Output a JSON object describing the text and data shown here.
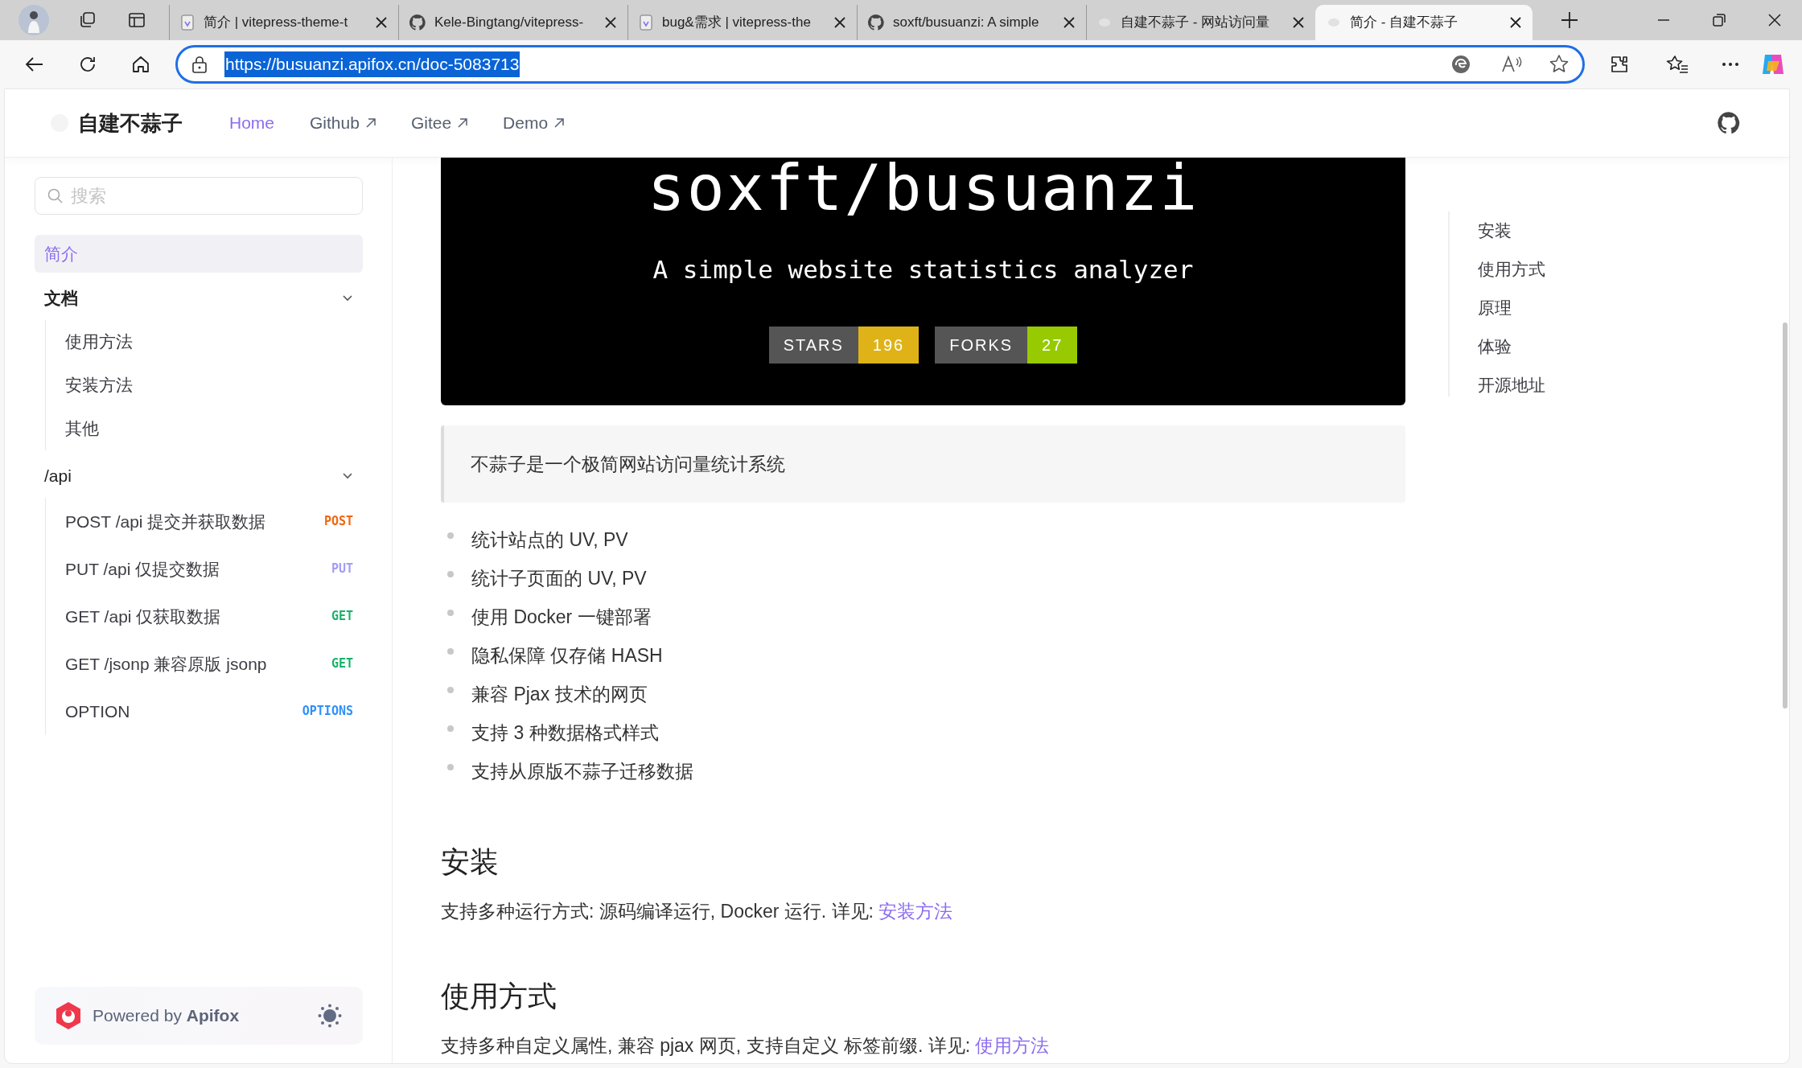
{
  "browser": {
    "tabs": [
      {
        "title": "简介 | vitepress-theme-t",
        "kind": "doc",
        "selected": false
      },
      {
        "title": "Kele-Bingtang/vitepress-",
        "kind": "github",
        "selected": false
      },
      {
        "title": "bug&需求 | vitepress-the",
        "kind": "doc",
        "selected": false
      },
      {
        "title": "soxft/busuanzi: A simple",
        "kind": "github",
        "selected": false
      },
      {
        "title": "自建不蒜子 - 网站访问量",
        "kind": "faint",
        "selected": false
      },
      {
        "title": "简介 - 自建不蒜子",
        "kind": "faint",
        "selected": true
      }
    ],
    "address": "https://busuanzi.apifox.cn/doc-5083713"
  },
  "site": {
    "title": "自建不蒜子",
    "nav": [
      {
        "label": "Home",
        "external": false,
        "selected": true
      },
      {
        "label": "Github",
        "external": true,
        "selected": false
      },
      {
        "label": "Gitee",
        "external": true,
        "selected": false
      },
      {
        "label": "Demo",
        "external": true,
        "selected": false
      }
    ]
  },
  "sidebar": {
    "search": {
      "placeholder": "搜索"
    },
    "items": [
      {
        "label": "简介",
        "kind": "page",
        "selected": true
      },
      {
        "label": "文档",
        "kind": "heading",
        "expanded": true,
        "children": [
          {
            "label": "使用方法",
            "selected": false
          },
          {
            "label": "安装方法",
            "selected": false
          },
          {
            "label": "其他",
            "selected": false
          }
        ]
      },
      {
        "label": "/api",
        "kind": "folder",
        "expanded": true,
        "children": [
          {
            "label": "POST /api 提交并获取数据",
            "method": "POST",
            "color": "#f0670f",
            "selected": false
          },
          {
            "label": "PUT /api 仅提交数据",
            "method": "PUT",
            "color": "#a39bf7",
            "selected": false
          },
          {
            "label": "GET /api 仅获取数据",
            "method": "GET",
            "color": "#17b26a",
            "selected": false
          },
          {
            "label": "GET /jsonp 兼容原版 jsonp",
            "method": "GET",
            "color": "#17b26a",
            "selected": false
          },
          {
            "label": "OPTION",
            "method": "OPTIONS",
            "color": "#2e90fa",
            "selected": false
          }
        ]
      }
    ],
    "footer": {
      "text": "Powered by **Apifox**"
    }
  },
  "banner": {
    "title": "soxft/**busuanzi**",
    "subtitle": "A simple website statistics analyzer",
    "badges": [
      {
        "label": "STARS",
        "value": "196",
        "color": "#dfb317"
      },
      {
        "label": "FORKS",
        "value": "27",
        "color": "#97ca00"
      }
    ]
  },
  "intro": "不蒜子是一个极简网站访问量统计系统",
  "features": [
    "统计站点的 UV, PV",
    "统计子页面的 UV, PV",
    "使用 Docker 一键部署",
    "隐私保障 仅存储 HASH",
    "兼容 Pjax 技术的网页",
    "支持 3 种数据格式样式",
    "支持从原版不蒜子迁移数据"
  ],
  "sections": [
    {
      "heading": "安装",
      "text": "支持多种运行方式: 源码编译运行, Docker 运行. 详见: ",
      "link": "安装方法"
    },
    {
      "heading": "使用方式",
      "text": "支持多种自定义属性, 兼容 pjax 网页, 支持自定义 标签前缀. 详见: ",
      "link": "使用方法"
    }
  ],
  "toc": [
    {
      "label": "安装"
    },
    {
      "label": "使用方式"
    },
    {
      "label": "原理"
    },
    {
      "label": "体验"
    },
    {
      "label": "开源地址"
    }
  ]
}
